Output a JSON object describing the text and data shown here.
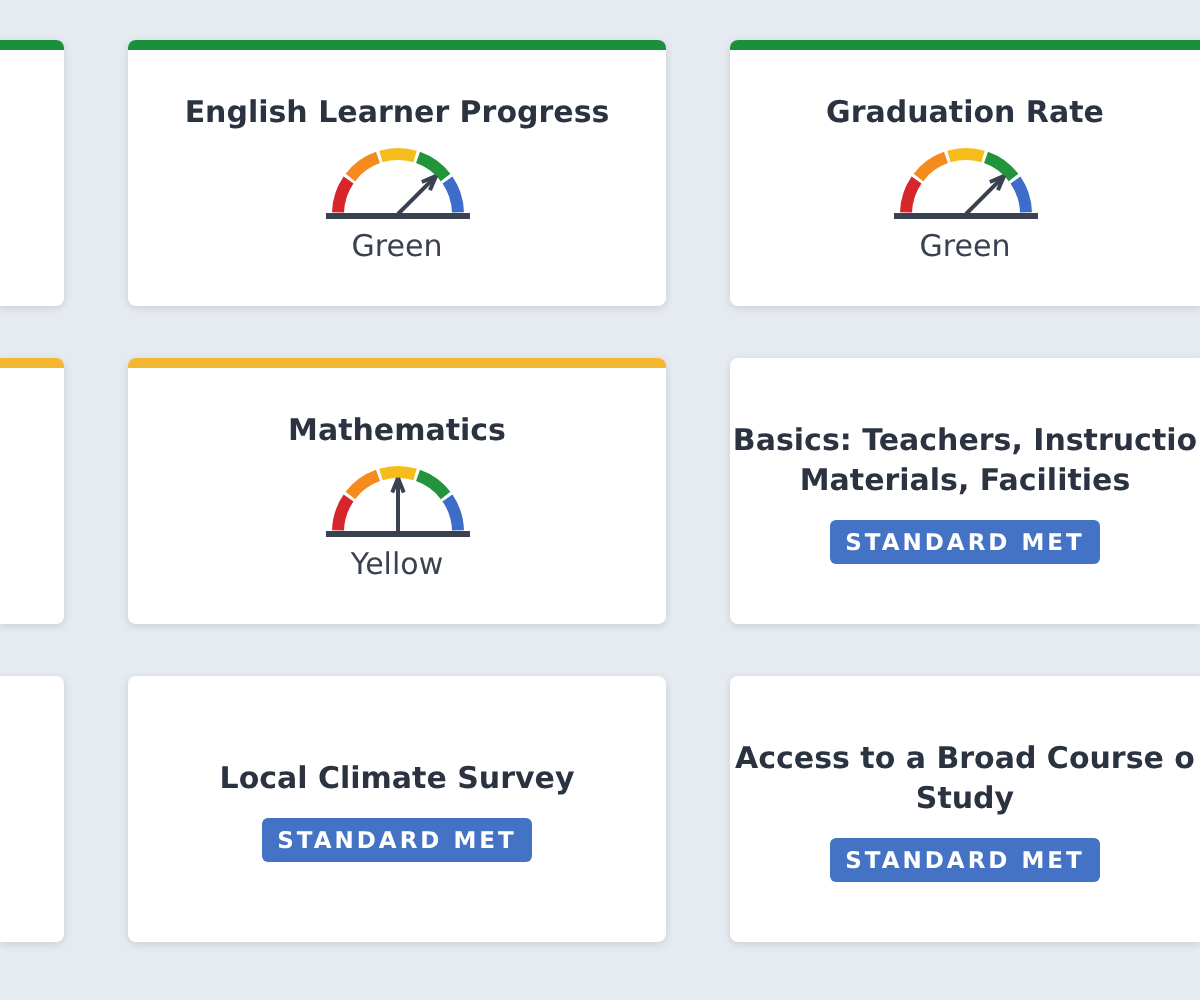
{
  "rows": [
    {
      "cards": [
        {
          "kind": "blank",
          "color": "#1a8f3c"
        },
        {
          "kind": "gauge",
          "color": "#1a8f3c",
          "title_lines": [
            "English Learner Progress"
          ],
          "level": 0.75,
          "status": "Green"
        },
        {
          "kind": "gauge",
          "color": "#1a8f3c",
          "title_lines": [
            "Graduation Rate"
          ],
          "level": 0.75,
          "status": "Green"
        }
      ]
    },
    {
      "cards": [
        {
          "kind": "blank",
          "color": "#f5b731"
        },
        {
          "kind": "gauge",
          "color": "#f5b731",
          "title_lines": [
            "Mathematics"
          ],
          "level": 0.5,
          "status": "Yellow"
        },
        {
          "kind": "badge",
          "title_lines": [
            "Basics: Teachers, Instructio",
            "Materials, Facilities"
          ],
          "badge": "STANDARD MET"
        }
      ]
    },
    {
      "cards": [
        {
          "kind": "blank"
        },
        {
          "kind": "badge",
          "title_lines": [
            "Local Climate Survey"
          ],
          "badge": "STANDARD MET"
        },
        {
          "kind": "badge",
          "title_lines": [
            "Access to a Broad Course o",
            "Study"
          ],
          "badge": "STANDARD MET"
        }
      ]
    }
  ]
}
